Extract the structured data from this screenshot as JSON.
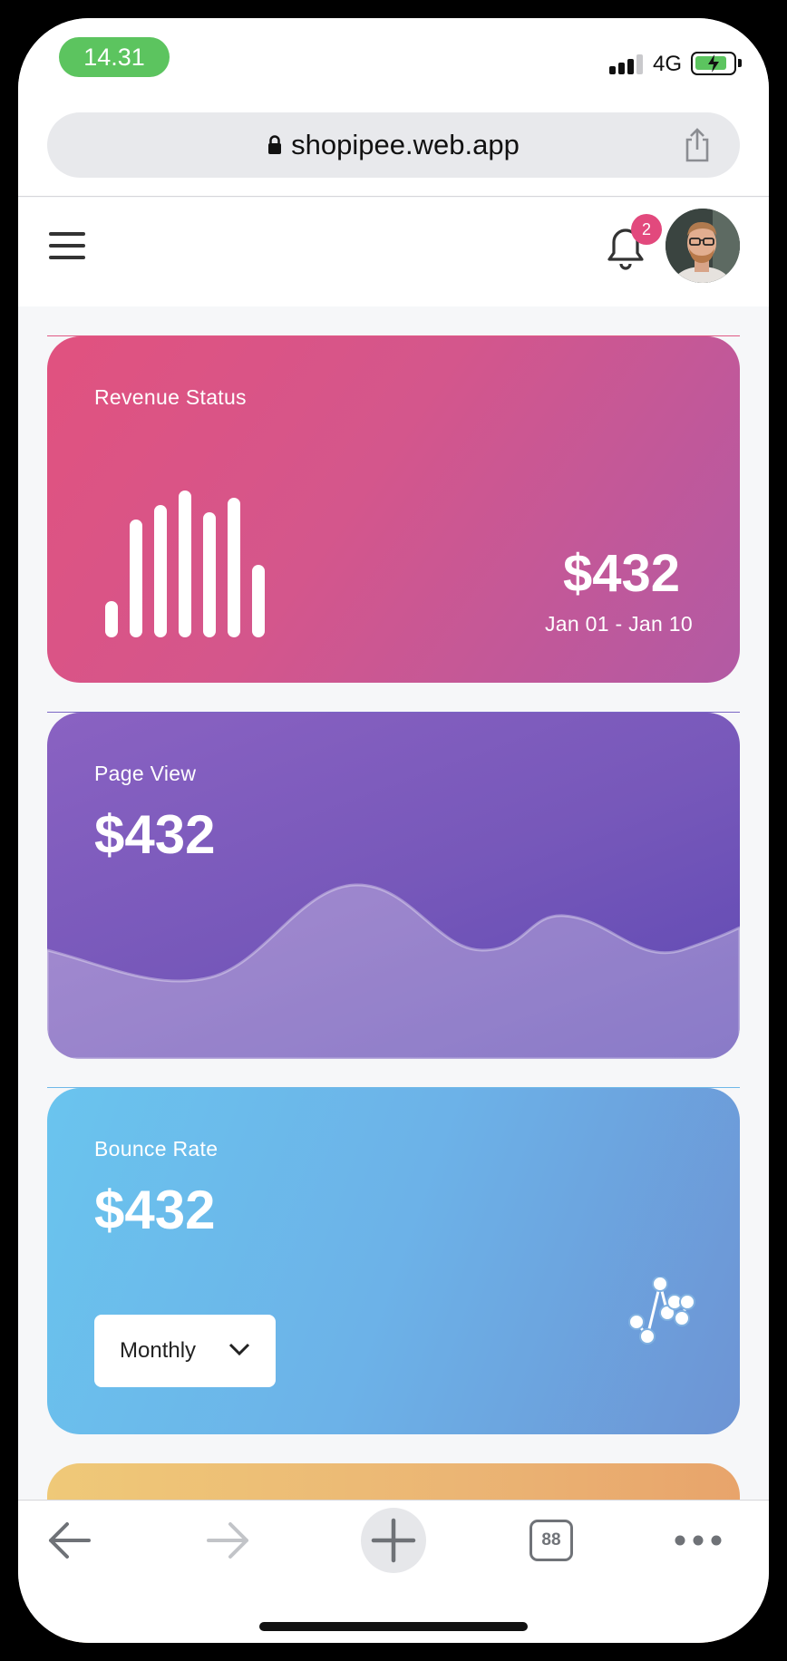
{
  "status_bar": {
    "time": "14.31",
    "network": "4G"
  },
  "browser": {
    "url": "shopipee.web.app",
    "tabs_count": "88"
  },
  "header": {
    "notification_count": "2"
  },
  "cards": {
    "revenue": {
      "label": "Revenue Status",
      "amount": "$432",
      "date_range": "Jan 01 - Jan 10"
    },
    "page_view": {
      "label": "Page View",
      "amount": "$432"
    },
    "bounce_rate": {
      "label": "Bounce Rate",
      "amount": "$432",
      "period": "Monthly"
    }
  },
  "colors": {
    "revenue_gradient": [
      "#e1527f",
      "#b25aa4"
    ],
    "pageview_gradient": [
      "#8a62c2",
      "#5d48b3"
    ],
    "bounce_gradient": [
      "#6ac4ee",
      "#6d94d4"
    ],
    "peek_gradient": [
      "#efc978",
      "#e8a46b"
    ],
    "status_green": "#5cc45f",
    "badge_pink": "#e2497d"
  },
  "icons": [
    "lock-icon",
    "share-icon",
    "menu-icon",
    "bell-icon",
    "back-arrow-icon",
    "forward-arrow-icon",
    "plus-icon",
    "tabs-icon",
    "more-icon",
    "bar-chart-icon",
    "scatter-icon",
    "chevron-down-icon"
  ]
}
